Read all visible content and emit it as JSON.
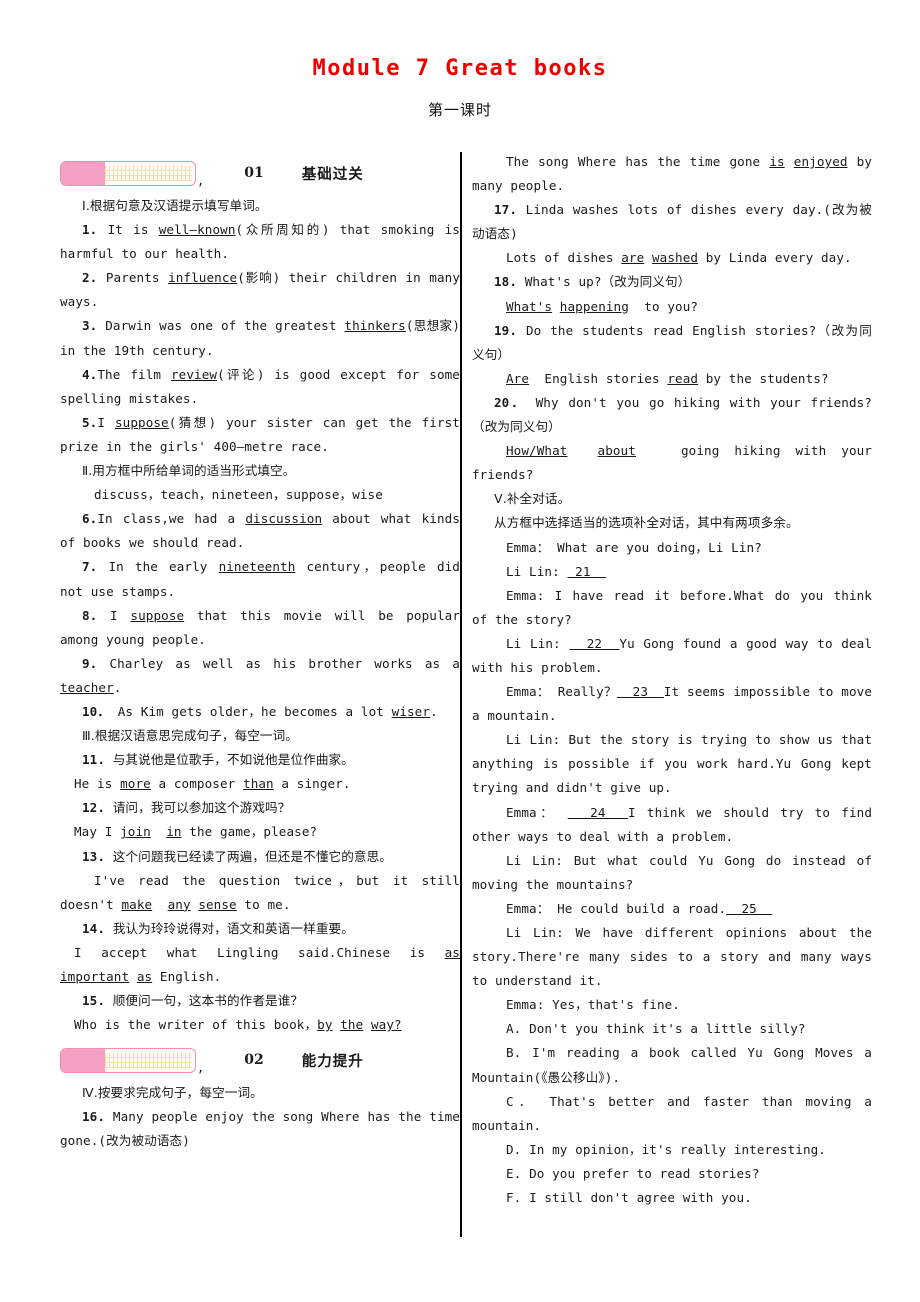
{
  "page": {
    "title": "Module 7 Great books",
    "subtitle": "第一课时",
    "title_color": "#ee0000"
  },
  "sections": [
    {
      "no": "01",
      "name": "基础过关",
      "comma": ","
    },
    {
      "no": "02",
      "name": "能力提升",
      "comma": ","
    }
  ],
  "left_column": {
    "part1_heading": "Ⅰ.根据句意及汉语提示填写单词。",
    "items": [
      {
        "n": "1.",
        "text": "It is well—known(众所周知的) that smoking is harmful to our health."
      },
      {
        "n": "2.",
        "text": "Parents influence(影响) their children in many ways."
      },
      {
        "n": "3.",
        "text": "Darwin was one of the greatest thinkers(思想家) in the 19th century."
      },
      {
        "n": "4.",
        "text": "The film review(评论) is good except for some spelling mistakes."
      },
      {
        "n": "5.",
        "text": "I suppose(猜想) your sister can get the first prize in the girls' 400—metre race."
      }
    ],
    "part2_heading": "Ⅱ.用方框中所给单词的适当形式填空。",
    "word_box": "discuss，teach，nineteen，suppose，wise",
    "items2": [
      {
        "n": "6.",
        "text": "In class,we had a discussion about what kinds of books we should read."
      },
      {
        "n": "7.",
        "text": "In the early nineteenth century，people did not use stamps."
      },
      {
        "n": "8.",
        "text": "I suppose that this movie will be popular among young people."
      },
      {
        "n": "9.",
        "text": "Charley as well as his brother works as a teacher."
      },
      {
        "n": "10．",
        "text": "As Kim gets older，he becomes a lot wiser."
      }
    ],
    "part3_heading": "Ⅲ.根据汉语意思完成句子，每空一词。",
    "items3": [
      {
        "n": "11.",
        "zh": "与其说他是位歌手，不如说他是位作曲家。",
        "en": "He is more a composer than a singer."
      },
      {
        "n": "12.",
        "zh": "请问，我可以参加这个游戏吗？",
        "en": "May I join in the game，please?"
      },
      {
        "n": "13.",
        "zh": "这个问题我已经读了两遍，但还是不懂它的意思。",
        "en": "I've read the question twice，but it still doesn't make any sense to me."
      },
      {
        "n": "14.",
        "zh": "我认为玲玲说得对，语文和英语一样重要。",
        "en": "I accept what Lingling said.Chinese is as important as English."
      },
      {
        "n": "15.",
        "zh": "顺便问一句，这本书的作者是谁？",
        "en": "Who is the writer of this book，by the way?"
      }
    ],
    "part4_heading": "Ⅳ.按要求完成句子，每空一词。",
    "items4": [
      {
        "n": "16.",
        "text": "Many people enjoy the song Where has the time gone.(改为被动语态)"
      }
    ]
  },
  "right_column": {
    "answer16": "The song Where has the time gone is enjoyed by many people.",
    "items": [
      {
        "n": "17.",
        "q": "Linda washes lots of dishes every day.(改为被动语态)",
        "a": "Lots of dishes are washed by Linda every day."
      },
      {
        "n": "18.",
        "q": "What's up?（改为同义句）",
        "a": "What's happening  to you?"
      },
      {
        "n": "19.",
        "q": "Do the students read English stories?（改为同义句）",
        "a": "Are  English stories read by the students?"
      },
      {
        "n": "20．",
        "q": "Why don't you go hiking with your friends?（改为同义句）",
        "a": "How/What  about   going hiking with your friends?"
      }
    ],
    "part5_heading": "Ⅴ.补全对话。",
    "part5_sub": "从方框中选择适当的选项补全对话，其中有两项多余。",
    "dialogue": [
      {
        "speaker": "Emma：",
        "text": "What are you doing，Li Lin?"
      },
      {
        "speaker": "Li Lin:",
        "text": " 21 "
      },
      {
        "speaker": "Emma:",
        "text": "I have read it before.What do you think of the story?"
      },
      {
        "speaker": "Li Lin:",
        "text": " 22 Yu Gong found a good way to deal with his problem."
      },
      {
        "speaker": "Emma：",
        "text": "Really？ 23 It seems impossible to move a mountain."
      },
      {
        "speaker": "Li Lin:",
        "text": "But the story is trying to show us that anything is possible if you work hard.Yu Gong kept trying and didn't give up."
      },
      {
        "speaker": "Emma：",
        "text": " 24 I think we should try to find other ways to deal with a problem."
      },
      {
        "speaker": "Li Lin:",
        "text": "But what could Yu Gong do instead of moving the mountains?"
      },
      {
        "speaker": "Emma：",
        "text": "He could build a road. 25 "
      },
      {
        "speaker": "Li Lin:",
        "text": "We have different opinions about the story.There're many sides to a story and many ways to understand it."
      },
      {
        "speaker": "Emma:",
        "text": "Yes，that's fine."
      }
    ],
    "options": [
      {
        "k": "A.",
        "text": "Don't you think it's a little silly?"
      },
      {
        "k": "B.",
        "text": "I'm reading a book called Yu Gong Moves a Mountain(《愚公移山》)."
      },
      {
        "k": "C．",
        "text": "That's better and faster than moving a mountain."
      },
      {
        "k": "D.",
        "text": "In my opinion，it's really interesting."
      },
      {
        "k": "E.",
        "text": "Do you prefer to read stories?"
      },
      {
        "k": "F.",
        "text": "I still don't agree with you."
      }
    ]
  }
}
